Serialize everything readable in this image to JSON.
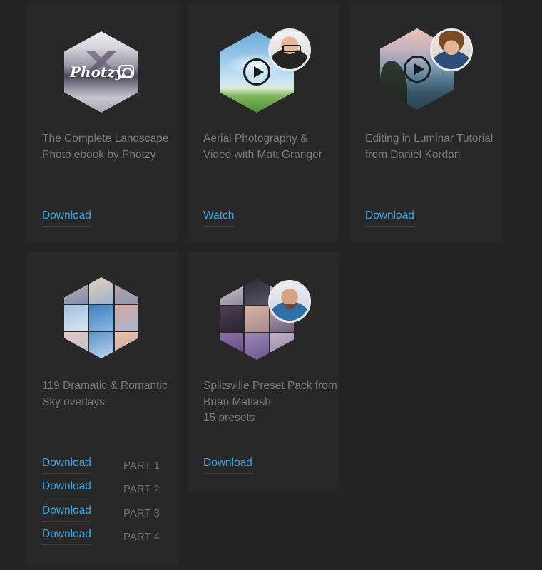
{
  "cards": [
    {
      "thumbnail": "photozy-landscape-hexagon",
      "logo_text": "Photzy",
      "title": "The Complete Landscape Photo ebook by Photzy",
      "action_label": "Download"
    },
    {
      "thumbnail": "aerial-sky-hexagon",
      "avatar": "matt-granger-avatar",
      "title": "Aerial Photography & Video with Matt Granger",
      "action_label": "Watch"
    },
    {
      "thumbnail": "coastal-sunset-hexagon",
      "avatar": "daniel-kordan-avatar",
      "title": "Editing in Luminar Tutorial from Daniel Kordan",
      "action_label": "Download"
    },
    {
      "thumbnail": "sky-overlays-mosaic-hexagon",
      "title": "119 Dramatic & Romantic Sky overlays",
      "downloads": [
        {
          "label": "Download",
          "part": "PART 1"
        },
        {
          "label": "Download",
          "part": "PART 2"
        },
        {
          "label": "Download",
          "part": "PART 3"
        },
        {
          "label": "Download",
          "part": "PART 4"
        }
      ]
    },
    {
      "thumbnail": "splitsville-portrait-mosaic-hexagon",
      "avatar": "brian-matiash-avatar",
      "title": "Splitsville Preset Pack from Brian Matiash",
      "subtitle": "15 presets",
      "action_label": "Download"
    }
  ],
  "colors": {
    "background": "#232323",
    "card": "#282828",
    "link": "#3aa6e6",
    "title_text": "#7a7a7a",
    "part_text": "#6e6e6e"
  }
}
